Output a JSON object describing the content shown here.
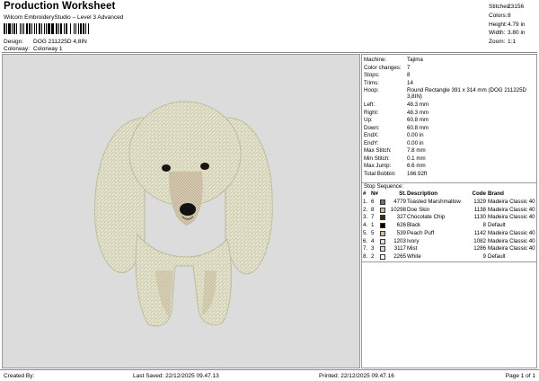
{
  "header": {
    "title": "Production Worksheet",
    "subtitle": "Wilcom EmbroideryStudio – Level 3 Advanced",
    "design_label": "Design:",
    "design_value": "DOG 211225D 4,8IN",
    "colorway_label": "Colorway:",
    "colorway_value": "Colorway 1"
  },
  "stats": [
    {
      "label": "Stitches:",
      "value": "23156"
    },
    {
      "label": "Colors:",
      "value": "8"
    },
    {
      "label": "Height:",
      "value": "4.79 in"
    },
    {
      "label": "Width:",
      "value": "3.80 in"
    },
    {
      "label": "Zoom:",
      "value": "1:1"
    }
  ],
  "machine_info": [
    {
      "label": "Machine:",
      "value": "Tajima"
    },
    {
      "label": "Color changes:",
      "value": "7"
    },
    {
      "label": "Stops:",
      "value": "8"
    },
    {
      "label": "Trims:",
      "value": "14"
    },
    {
      "label": "Hoop:",
      "value": "Round Rectangle 391 x 314 mm (DOG 211225D 3,8IN)"
    },
    {
      "label": "Left:",
      "value": "48.3 mm"
    },
    {
      "label": "Right:",
      "value": "48.3 mm"
    },
    {
      "label": "Up:",
      "value": "60.8 mm"
    },
    {
      "label": "Down:",
      "value": "60.8 mm"
    },
    {
      "label": "EndX:",
      "value": "0.00 in"
    },
    {
      "label": "EndY:",
      "value": "0.00 in"
    },
    {
      "label": "Max Stitch:",
      "value": "7.8 mm"
    },
    {
      "label": "Min Stitch:",
      "value": "0.1 mm"
    },
    {
      "label": "Max Jump:",
      "value": "6.6 mm"
    },
    {
      "label": "Total Bobbin:",
      "value": "166.92ft"
    }
  ],
  "stop_sequence": {
    "title": "Stop Sequence:",
    "headers": {
      "num": "#",
      "n": "N#",
      "st": "St.",
      "desc": "Description",
      "code": "Code",
      "brand": "Brand"
    },
    "rows": [
      {
        "num": "1.",
        "n": "6",
        "color": "#8b6a55",
        "st": "4779",
        "desc": "Toasted Marshmallow",
        "code": "1329",
        "brand": "Madeira Classic 40"
      },
      {
        "num": "2.",
        "n": "8",
        "color": "#cdb89c",
        "st": "10298",
        "desc": "Doe Skin",
        "code": "1138",
        "brand": "Madeira Classic 40"
      },
      {
        "num": "3.",
        "n": "7",
        "color": "#3a2a22",
        "st": "327",
        "desc": "Chocolate Chip",
        "code": "1130",
        "brand": "Madeira Classic 40"
      },
      {
        "num": "4.",
        "n": "1",
        "color": "#000000",
        "st": "626",
        "desc": "Black",
        "code": "8",
        "brand": "Default"
      },
      {
        "num": "5.",
        "n": "5",
        "color": "#d9b88f",
        "st": "539",
        "desc": "Peach Puff",
        "code": "1142",
        "brand": "Madeira Classic 40"
      },
      {
        "num": "6.",
        "n": "4",
        "color": "#e8ddc6",
        "st": "1203",
        "desc": "Ivory",
        "code": "1082",
        "brand": "Madeira Classic 40"
      },
      {
        "num": "7.",
        "n": "3",
        "color": "#d7dcd4",
        "st": "3117",
        "desc": "Mist",
        "code": "1286",
        "brand": "Madeira Classic 40"
      },
      {
        "num": "8.",
        "n": "2",
        "color": "#ffffff",
        "st": "2265",
        "desc": "White",
        "code": "9",
        "brand": "Default"
      }
    ]
  },
  "footer": {
    "created_by": "Created By:",
    "last_saved": "Last Saved: 22/12/2025 09.47.13",
    "printed": "Printed: 22/12/2025 09.47.16",
    "page": "Page 1 of 1"
  }
}
